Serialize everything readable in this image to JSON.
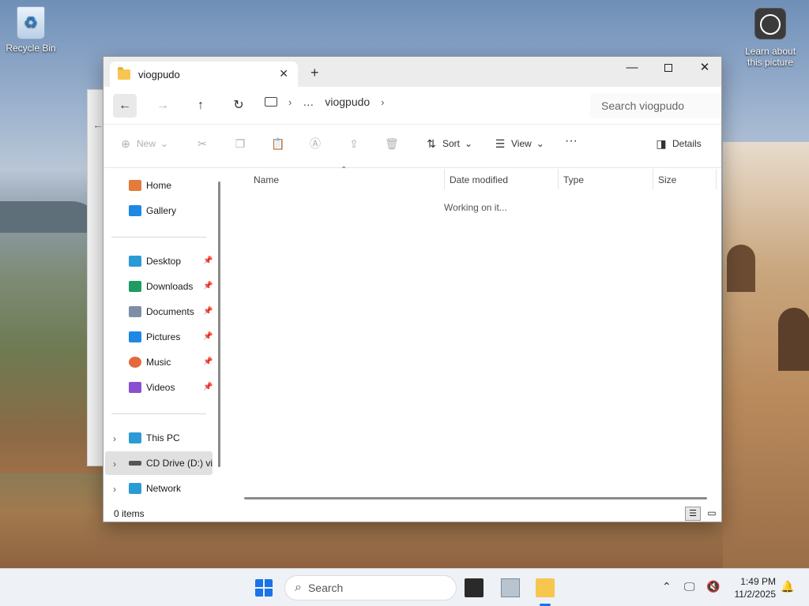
{
  "desktop": {
    "icons": [
      {
        "label": "Recycle Bin"
      },
      {
        "label": "Learn about this picture"
      }
    ]
  },
  "window": {
    "tab_title": "viogpudo",
    "controls": {
      "minimize": "—",
      "maximize": "",
      "close": "✕"
    }
  },
  "navbar": {
    "breadcrumb": [
      "…",
      "viogpudo"
    ],
    "search_placeholder": "Search viogpudo"
  },
  "toolbar": {
    "new_label": "New",
    "sort_label": "Sort",
    "view_label": "View",
    "more_label": "···",
    "details_label": "Details"
  },
  "sidebar": {
    "home": "Home",
    "gallery": "Gallery",
    "quick": [
      {
        "label": "Desktop",
        "color": "#2b9bd6"
      },
      {
        "label": "Downloads",
        "color": "#1f9c62"
      },
      {
        "label": "Documents",
        "color": "#7d8fa6"
      },
      {
        "label": "Pictures",
        "color": "#1e88e5"
      },
      {
        "label": "Music",
        "color": "#e36a3c"
      },
      {
        "label": "Videos",
        "color": "#8a4fd0"
      }
    ],
    "this_pc": "This PC",
    "cd_drive": "CD Drive (D:) vir",
    "network": "Network"
  },
  "columns": [
    "Name",
    "Date modified",
    "Type",
    "Size"
  ],
  "content": {
    "status": "Working on it..."
  },
  "statusbar": {
    "items": "0 items"
  },
  "taskbar": {
    "search_placeholder": "Search",
    "time": "1:49 PM",
    "date": "11/2/2025"
  }
}
